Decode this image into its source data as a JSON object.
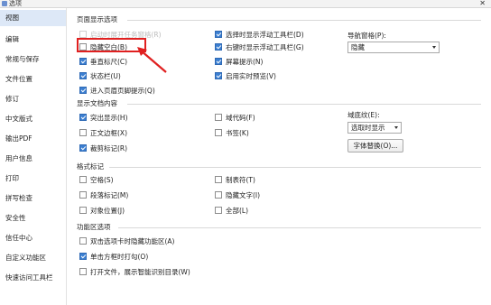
{
  "window": {
    "title": "选项"
  },
  "sidebar": {
    "items": [
      {
        "label": "视图",
        "active": true
      },
      {
        "label": "编辑"
      },
      {
        "label": "常规与保存"
      },
      {
        "label": "文件位置"
      },
      {
        "label": "修订"
      },
      {
        "label": "中文版式"
      },
      {
        "label": "输出PDF"
      },
      {
        "label": "用户信息"
      },
      {
        "label": "打印"
      },
      {
        "label": "拼写检查"
      },
      {
        "label": "安全性"
      },
      {
        "label": "信任中心"
      },
      {
        "label": "自定义功能区"
      },
      {
        "label": "快速访问工具栏"
      }
    ]
  },
  "page_display": {
    "title": "页面显示选项",
    "col1": [
      {
        "label": "启动时展开任务窗格(R)",
        "checked": false,
        "faded": true
      },
      {
        "label": "隐藏空白(B)",
        "checked": false
      },
      {
        "label": "垂直标尺(C)",
        "checked": true
      },
      {
        "label": "状态栏(U)",
        "checked": true
      },
      {
        "label": "进入页眉页脚提示(Q)",
        "checked": true
      }
    ],
    "col2": [
      {
        "label": "选择时显示浮动工具栏(D)",
        "checked": true
      },
      {
        "label": "右键时显示浮动工具栏(G)",
        "checked": true
      },
      {
        "label": "屏幕提示(N)",
        "checked": true
      },
      {
        "label": "启用实时预览(V)",
        "checked": true
      }
    ],
    "nav_pane_label": "导航窗格(P):",
    "nav_pane_value": "隐藏"
  },
  "doc_content": {
    "title": "显示文档内容",
    "col1": [
      {
        "label": "突出显示(H)",
        "checked": true
      },
      {
        "label": "正文边框(X)",
        "checked": false
      },
      {
        "label": "裁剪标记(R)",
        "checked": true
      }
    ],
    "col2": [
      {
        "label": "域代码(F)",
        "checked": false
      },
      {
        "label": "书签(K)",
        "checked": false
      }
    ],
    "field_shading_label": "域底纹(E):",
    "field_shading_value": "选取时显示",
    "font_replace_button": "字体替换(O)..."
  },
  "format_marks": {
    "title": "格式标记",
    "col1": [
      {
        "label": "空格(S)",
        "checked": false
      },
      {
        "label": "段落标记(M)",
        "checked": false
      },
      {
        "label": "对象位置(J)",
        "checked": false
      }
    ],
    "col2": [
      {
        "label": "制表符(T)",
        "checked": false
      },
      {
        "label": "隐藏文字(I)",
        "checked": false
      },
      {
        "label": "全部(L)",
        "checked": false
      }
    ]
  },
  "ribbon_options": {
    "title": "功能区选项",
    "items": [
      {
        "label": "双击选项卡时隐藏功能区(A)",
        "checked": false
      },
      {
        "label": "单击方框时打勾(O)",
        "checked": true
      },
      {
        "label": "打开文件，展示智能识别目录(W)",
        "checked": false
      }
    ]
  },
  "colors": {
    "accent": "#3c7fd1",
    "highlight": "#e02020",
    "active_bg": "#dde8f7"
  }
}
